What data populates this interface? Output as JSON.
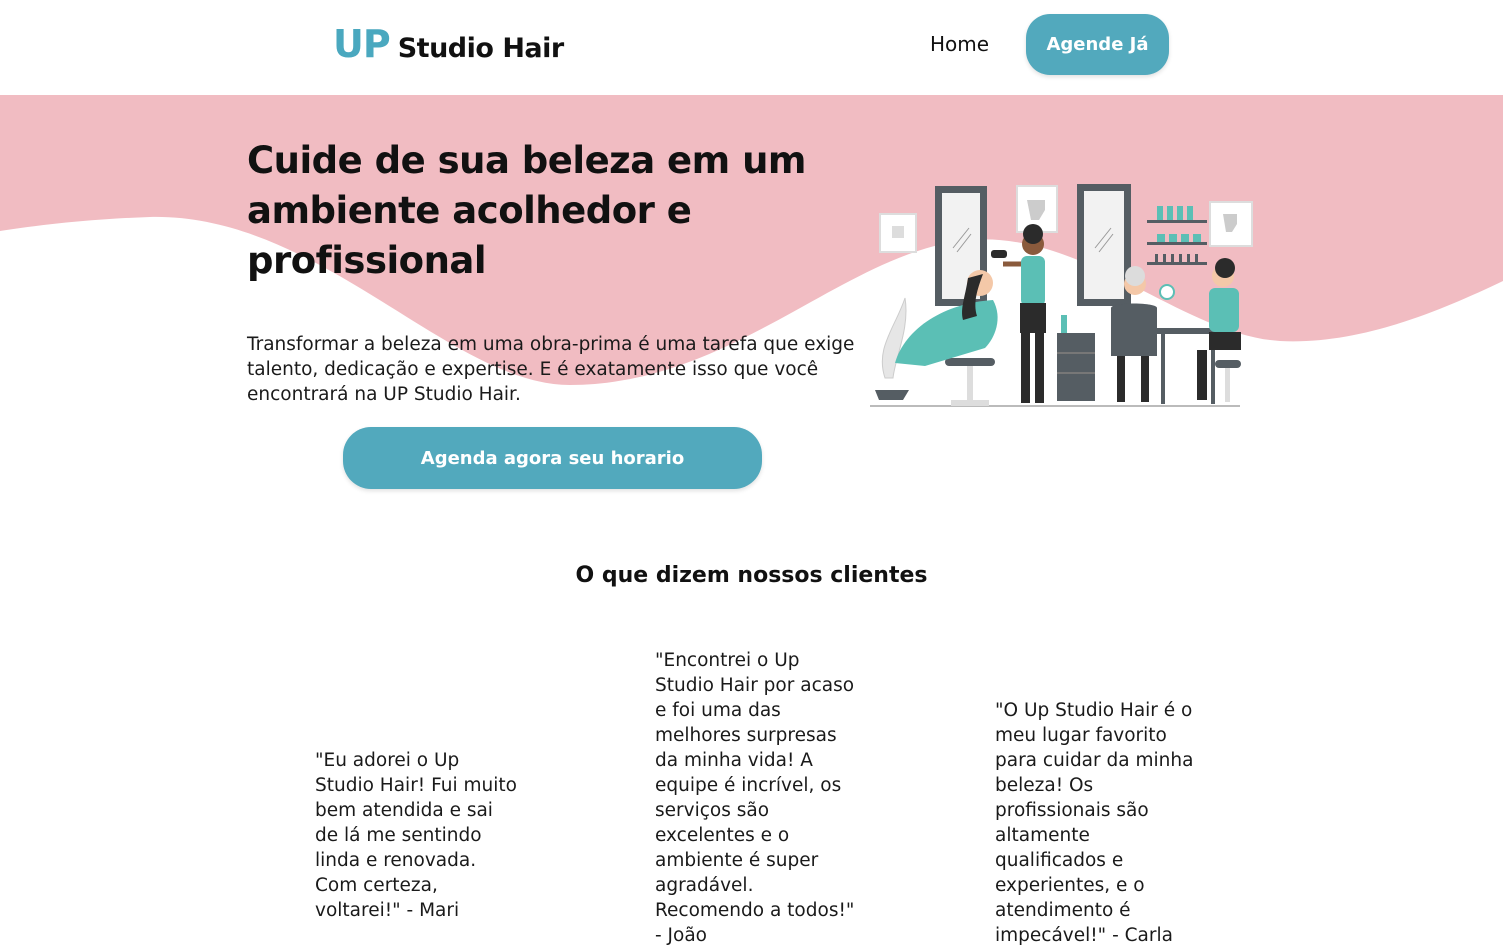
{
  "header": {
    "logo_mark": "UP",
    "logo_name": "Studio Hair",
    "nav_home": "Home",
    "cta_label": "Agende Já"
  },
  "hero": {
    "title": "Cuide de sua beleza em um ambiente acolhedor e profissional",
    "text": "Transformar a beleza em uma obra-prima é uma tarefa que exige talento, dedicação e expertise. E é exatamente isso que você encontrará na UP Studio Hair.",
    "cta_label": "Agenda agora seu horario",
    "illustration": "hair-salon-illustration"
  },
  "testimonials": {
    "title": "O que dizem nossos clientes",
    "items": [
      {
        "quote": "\"Eu adorei o Up Studio Hair! Fui muito bem atendida e sai de lá me sentindo linda e renovada. Com certeza, voltarei!\" - Mari"
      },
      {
        "quote": "\"Encontrei o Up Studio Hair por acaso e foi uma das melhores surpresas da minha vida! A equipe é incrível, os serviços são excelentes e o ambiente é super agradável. Recomendo a todos!\" - João"
      },
      {
        "quote": "\"O Up Studio Hair é o meu lugar favorito para cuidar da minha beleza! Os profissionais são altamente qualificados e experientes, e o atendimento é impecável!\" - Carla"
      }
    ]
  },
  "colors": {
    "accent": "#52a9bd",
    "hero_pink": "#f1bcc2",
    "text": "#111111"
  }
}
